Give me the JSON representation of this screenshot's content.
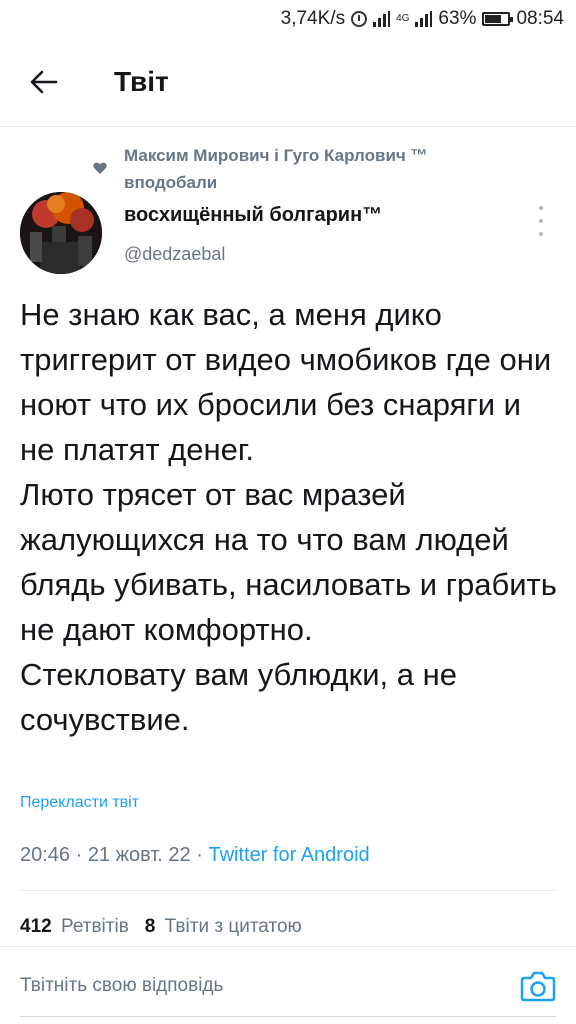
{
  "status_bar": {
    "speed": "3,74K/s",
    "network": "4G",
    "battery": "63%",
    "time": "08:54"
  },
  "header": {
    "title": "Твіт",
    "back_icon": "arrow-left-icon"
  },
  "social_context": {
    "text": "Максим Мирович і Гуго Карлович ™ вподобали",
    "icon": "heart-icon"
  },
  "author": {
    "name": "восхищённый болгарин™",
    "handle": "@dedzaebal"
  },
  "tweet": {
    "text": "Не знаю как вас, а меня дико триггерит от видео чмобиков где они ноют что их бросили без снаряги и не платят денег.\nЛюто трясет от вас мразей жалующихся на то что вам людей блядь убивать, насиловать и грабить не дают комфортно.\nСтекловату вам ублюдки, а не сочувствие.",
    "translate_label": "Перекласти твіт",
    "time": "20:46",
    "date": "21 жовт. 22",
    "separator": "·",
    "client": "Twitter for Android"
  },
  "stats": {
    "retweets_count": "412",
    "retweets_label": "Ретвітів",
    "quotes_count": "8",
    "quotes_label": "Твіти з цитатою"
  },
  "reply": {
    "placeholder": "Твітніть свою відповідь",
    "camera_icon": "camera-icon"
  },
  "colors": {
    "accent": "#1da1f2",
    "secondary_text": "#657786",
    "primary_text": "#14171a"
  }
}
